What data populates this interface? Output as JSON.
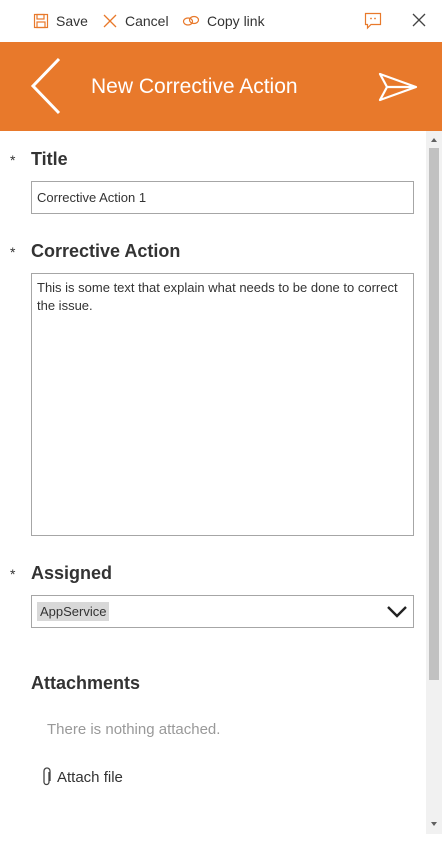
{
  "toolbar": {
    "save_label": "Save",
    "cancel_label": "Cancel",
    "copy_link_label": "Copy link"
  },
  "header": {
    "title": "New Corrective Action",
    "background_color": "#e8792b"
  },
  "form": {
    "required_mark": "*",
    "title": {
      "label": "Title",
      "value": "Corrective Action 1"
    },
    "corrective_action": {
      "label": "Corrective Action",
      "value": "This is some text that explain what needs to be done to correct the issue."
    },
    "assigned": {
      "label": "Assigned",
      "value": "AppService"
    },
    "attachments": {
      "label": "Attachments",
      "empty_text": "There is nothing attached.",
      "attach_label": "Attach file"
    }
  },
  "colors": {
    "accent": "#e8792b",
    "border": "#a6a6a6"
  },
  "scrollbar": {
    "position_fraction": 0
  }
}
